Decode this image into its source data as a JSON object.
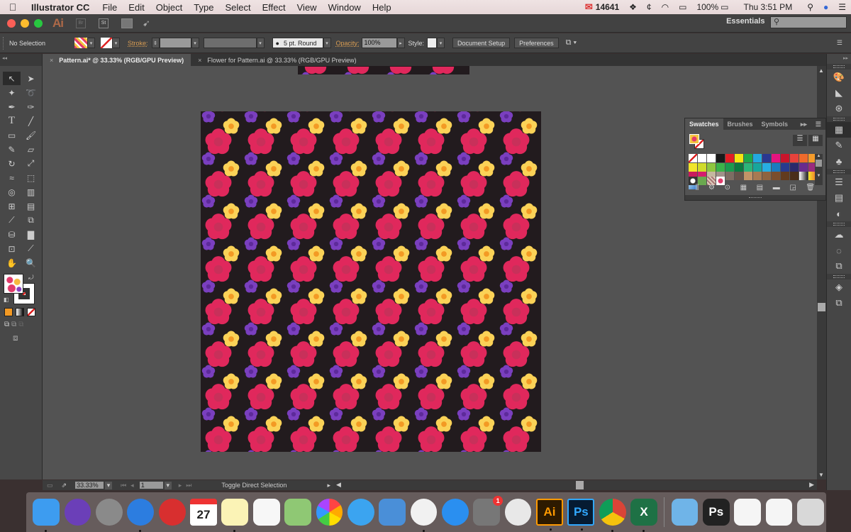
{
  "menubar": {
    "app_name": "Illustrator CC",
    "items": [
      "File",
      "Edit",
      "Object",
      "Type",
      "Select",
      "Effect",
      "View",
      "Window",
      "Help"
    ],
    "mail_count": "14641",
    "battery": "100%",
    "clock": "Thu 3:51 PM"
  },
  "appbar": {
    "logo": "Ai",
    "bridge": "Br",
    "stock": "St",
    "workspace": "Essentials",
    "search_placeholder": ""
  },
  "control": {
    "selection": "No Selection",
    "stroke_label": "Stroke:",
    "brush": "5 pt. Round",
    "opacity_label": "Opacity:",
    "opacity_value": "100%",
    "style_label": "Style:",
    "document_setup": "Document Setup",
    "preferences": "Preferences"
  },
  "tabs": [
    {
      "label": "Pattern.ai* @ 33.33% (RGB/GPU Preview)",
      "active": true
    },
    {
      "label": "Flower for Pattern.ai @ 33.33% (RGB/GPU Preview)",
      "active": false
    }
  ],
  "status": {
    "zoom": "33.33%",
    "page": "1",
    "tool_hint": "Toggle Direct Selection"
  },
  "swatches": {
    "tabs": [
      "Swatches",
      "Brushes",
      "Symbols"
    ],
    "colors": [
      "#ffffff",
      "#ffffff",
      "#ffffff",
      "#1a1a1a",
      "#e31e24",
      "#f4e511",
      "#1fa84a",
      "#23a8e0",
      "#2a3790",
      "#e5147f",
      "#c9152b",
      "#e8423b",
      "#ef6a2b",
      "#f59c2b",
      "#f2e52b",
      "#cfdb2a",
      "#8ec63f",
      "#3bb34a",
      "#1b9b4e",
      "#0b7a40",
      "#2cb47a",
      "#17a69c",
      "#27aee3",
      "#1a7bbf",
      "#273b8e",
      "#2b2a6b",
      "#6a2b8e",
      "#9b2a7d",
      "#c91a5d",
      "#d51c6e",
      "#c5b7a0",
      "#a1928a",
      "#7d6d63",
      "#65544b",
      "#c29467",
      "#a77a52",
      "#8e6441",
      "#7a4e2d",
      "#623b1e",
      "#4a2e1b",
      "#bfbfbf",
      "#f5b82a"
    ],
    "footer_icons": [
      "library-icon",
      "swatch-options-icon",
      "color-group-icon",
      "swatch-kind-icon",
      "show-options-icon",
      "new-color-group-icon",
      "new-swatch-icon",
      "delete-swatch-icon"
    ]
  },
  "pattern": {
    "background": "#221b1e",
    "pink": "#e0285c",
    "yellow": "#fbd257",
    "orange": "#f39a24",
    "purple": "#7a3fbf"
  },
  "dock": [
    {
      "name": "finder",
      "label": "",
      "color": "#3d9cf0",
      "running": true
    },
    {
      "name": "siri",
      "label": "",
      "color": "#6b3fb8",
      "running": false
    },
    {
      "name": "launchpad",
      "label": "",
      "color": "#8a8a8a",
      "running": false
    },
    {
      "name": "safari",
      "label": "",
      "color": "#2c7de0",
      "running": true
    },
    {
      "name": "mail",
      "label": "",
      "color": "#d82f2f",
      "running": false
    },
    {
      "name": "calendar",
      "label": "27",
      "color": "#ffffff",
      "running": false
    },
    {
      "name": "notes",
      "label": "",
      "color": "#fbf3b6",
      "running": true
    },
    {
      "name": "reminders",
      "label": "",
      "color": "#f7f7f7",
      "running": false
    },
    {
      "name": "maps",
      "label": "",
      "color": "#8fc874",
      "running": false
    },
    {
      "name": "photos",
      "label": "",
      "color": "#f2f2f2",
      "running": false
    },
    {
      "name": "messages",
      "label": "",
      "color": "#3ba4f0",
      "running": false
    },
    {
      "name": "keynote",
      "label": "",
      "color": "#4a8fd8",
      "running": false
    },
    {
      "name": "itunes",
      "label": "",
      "color": "#f1f1f1",
      "running": true
    },
    {
      "name": "app-store",
      "label": "",
      "color": "#2a8ff0",
      "running": false
    },
    {
      "name": "system-preferences",
      "label": "",
      "color": "#777777",
      "running": false,
      "badge": "1"
    },
    {
      "name": "image-capture",
      "label": "",
      "color": "#e8e8e8",
      "running": false
    },
    {
      "name": "illustrator",
      "label": "Ai",
      "color": "#2d1a00",
      "running": true
    },
    {
      "name": "photoshop",
      "label": "Ps",
      "color": "#061b32",
      "running": true
    },
    {
      "name": "chrome",
      "label": "",
      "color": "#eeeeee",
      "running": true
    },
    {
      "name": "excel",
      "label": "X",
      "color": "#1e7145",
      "running": true
    },
    {
      "name": "downloads",
      "label": "",
      "color": "#6fb4e8",
      "running": false
    },
    {
      "name": "ps-document",
      "label": "Ps",
      "color": "#222222",
      "running": false
    },
    {
      "name": "document-1",
      "label": "",
      "color": "#f5f5f5",
      "running": false
    },
    {
      "name": "document-2",
      "label": "",
      "color": "#f5f5f5",
      "running": false
    },
    {
      "name": "trash",
      "label": "",
      "color": "#d8d8d8",
      "running": false
    }
  ]
}
